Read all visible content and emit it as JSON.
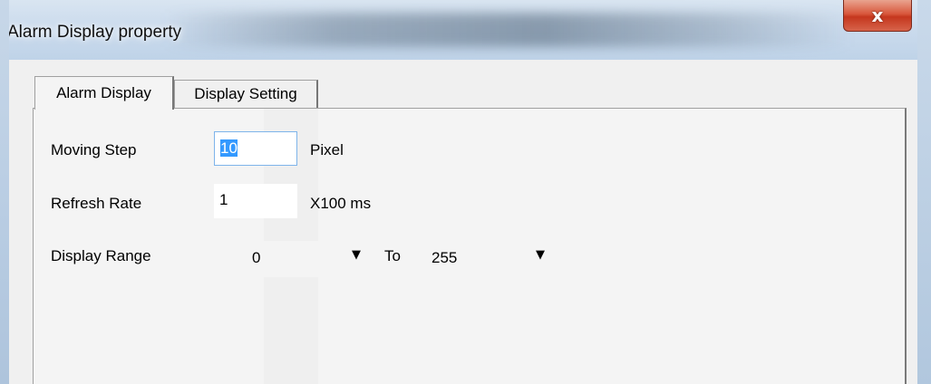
{
  "window": {
    "title": "Alarm Display property",
    "close_glyph": "x"
  },
  "tabs": [
    {
      "label": "Alarm Display",
      "active": true
    },
    {
      "label": "Display Setting",
      "active": false
    }
  ],
  "form": {
    "moving_step": {
      "label": "Moving Step",
      "value": "10",
      "unit": "Pixel"
    },
    "refresh_rate": {
      "label": "Refresh Rate",
      "value": "1",
      "unit": "X100 ms"
    },
    "display_range": {
      "label": "Display Range",
      "from": "0",
      "to_label": "To",
      "to": "255"
    }
  },
  "icons": {
    "dropdown": "chevron-down-icon",
    "close": "close-icon"
  }
}
